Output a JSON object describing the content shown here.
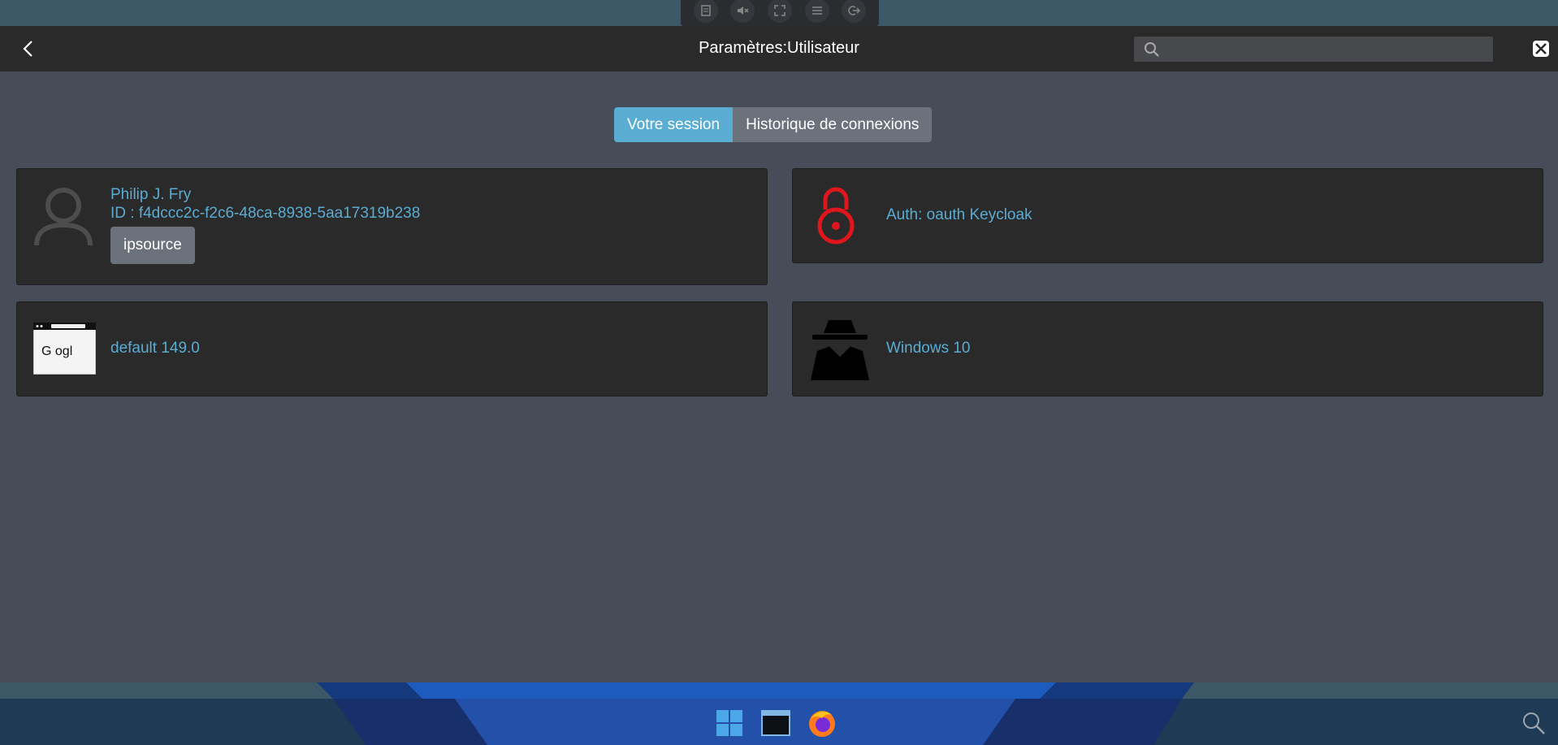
{
  "window": {
    "title": "Paramètres:Utilisateur",
    "search_placeholder": ""
  },
  "tabs": [
    {
      "label": "Votre session",
      "active": true
    },
    {
      "label": "Historique de connexions",
      "active": false
    }
  ],
  "user_card": {
    "name": "Philip J. Fry",
    "id": "ID : f4dccc2c-f2c6-48ca-8938-5aa17319b238",
    "button_label": "ipsource"
  },
  "auth_card": {
    "text": "Auth: oauth Keycloak",
    "icon": "lock-icon"
  },
  "browser_card": {
    "text": "default 149.0",
    "icon": "browser-icon",
    "thumbnail_text": "G ogl"
  },
  "os_card": {
    "text": "Windows 10",
    "icon": "incognito-icon"
  },
  "colors": {
    "accent": "#5aacd2",
    "lock": "#e0161e",
    "background": "#474d58",
    "card": "#2a2a2b"
  }
}
